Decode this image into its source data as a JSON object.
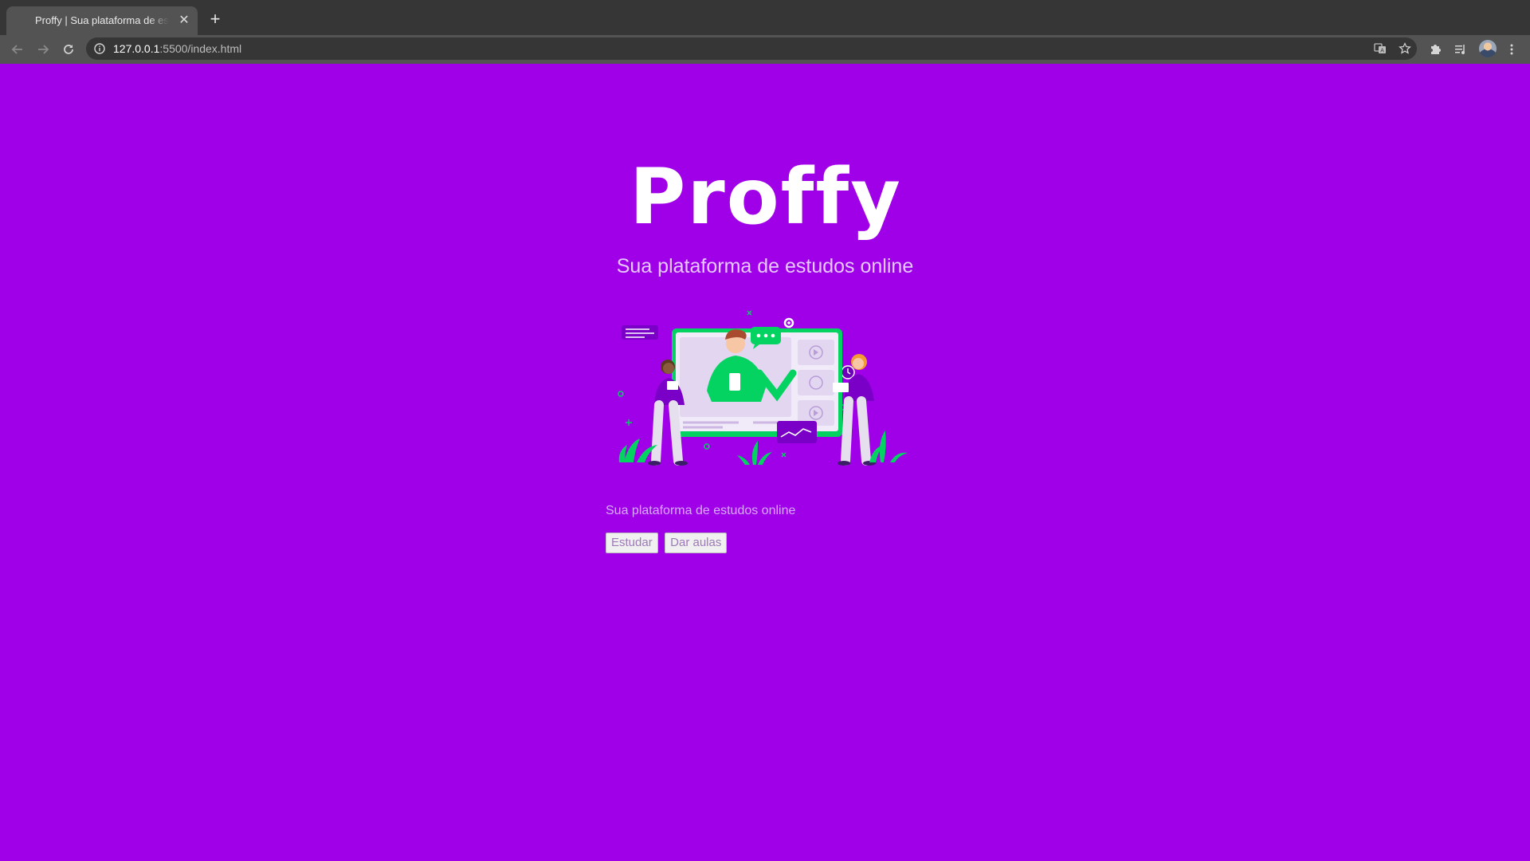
{
  "browser": {
    "tab_title": "Proffy | Sua plataforma de estudos online",
    "url_host": "127.0.0.1",
    "url_rest": ":5500/index.html"
  },
  "page": {
    "logo_text": "Proffy",
    "tagline": "Sua plataforma de estudos online",
    "subtitle": "Sua plataforma de estudos online",
    "buttons": {
      "study": "Estudar",
      "teach": "Dar aulas"
    }
  },
  "colors": {
    "background": "#A000E8",
    "illustration_green": "#04D361",
    "illustration_purple": "#7A00C8"
  },
  "icons": {
    "back": "arrow-left-icon",
    "forward": "arrow-right-icon",
    "reload": "reload-icon",
    "site_info": "info-icon",
    "translate": "translate-icon",
    "bookmark": "star-icon",
    "extensions": "puzzle-icon",
    "media": "playlist-icon",
    "menu": "kebab-menu-icon"
  }
}
